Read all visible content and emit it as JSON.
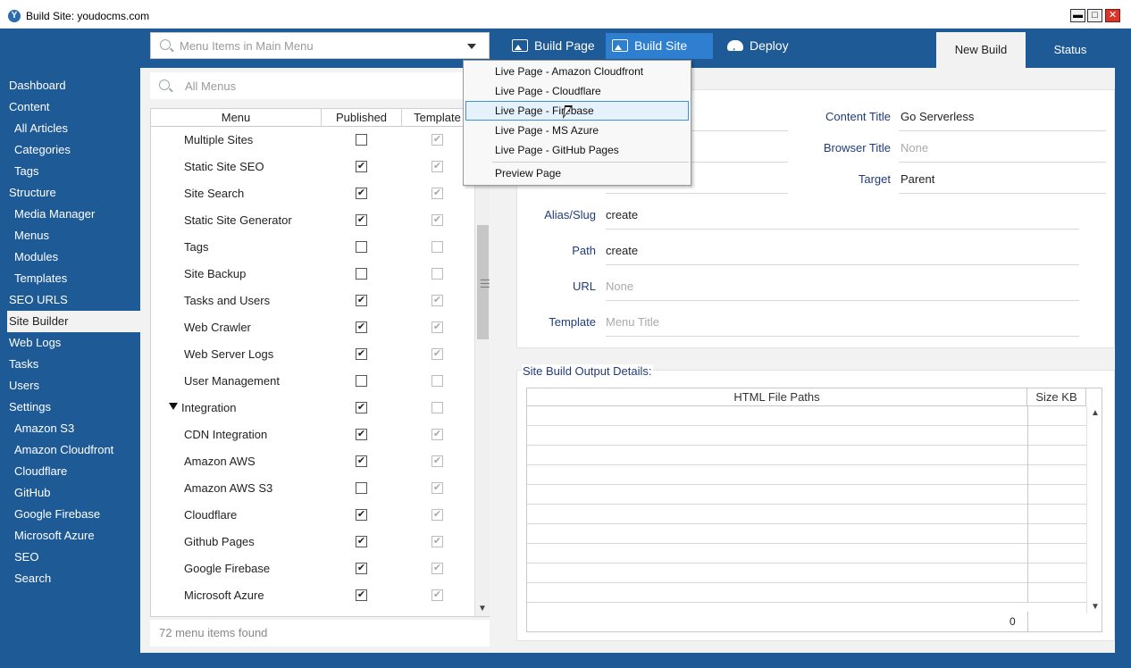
{
  "window": {
    "title": "Build Site: youdocms.com",
    "app_icon": "app-icon",
    "buttons": {
      "minimize": "▬",
      "maximize": "□",
      "close": "✕"
    }
  },
  "toolbar": {
    "menu_search_placeholder": "Menu Items in Main Menu",
    "build_page_label": "Build Page",
    "build_site_label": "Build Site",
    "deploy_label": "Deploy",
    "tabs": [
      {
        "label": "New Build",
        "active": true
      },
      {
        "label": "Status",
        "active": false
      }
    ]
  },
  "sidebar": {
    "active_index": 11,
    "items": [
      {
        "label": "Dashboard",
        "sub": false
      },
      {
        "label": "Content",
        "sub": false
      },
      {
        "label": "All Articles",
        "sub": true
      },
      {
        "label": "Categories",
        "sub": true
      },
      {
        "label": "Tags",
        "sub": true
      },
      {
        "label": "Structure",
        "sub": false
      },
      {
        "label": "Media Manager",
        "sub": true
      },
      {
        "label": "Menus",
        "sub": true
      },
      {
        "label": "Modules",
        "sub": true
      },
      {
        "label": "Templates",
        "sub": true
      },
      {
        "label": "SEO URLS",
        "sub": false
      },
      {
        "label": "Site Builder",
        "sub": false
      },
      {
        "label": "Web Logs",
        "sub": false
      },
      {
        "label": "Tasks",
        "sub": false
      },
      {
        "label": "Users",
        "sub": false
      },
      {
        "label": "Settings",
        "sub": false
      },
      {
        "label": "Amazon S3",
        "sub": true
      },
      {
        "label": "Amazon Cloudfront",
        "sub": true
      },
      {
        "label": "Cloudflare",
        "sub": true
      },
      {
        "label": "GitHub",
        "sub": true
      },
      {
        "label": "Google Firebase",
        "sub": true
      },
      {
        "label": "Microsoft Azure",
        "sub": true
      },
      {
        "label": "SEO",
        "sub": true
      },
      {
        "label": "Search",
        "sub": true
      }
    ]
  },
  "menus_panel": {
    "search_placeholder": "All Menus",
    "columns": {
      "menu": "Menu",
      "published": "Published",
      "template": "Template"
    },
    "rows": [
      {
        "label": "Multiple Sites",
        "published": false,
        "template": true,
        "parent": false
      },
      {
        "label": "Static Site SEO",
        "published": true,
        "template": true,
        "parent": false
      },
      {
        "label": "Site Search",
        "published": true,
        "template": true,
        "parent": false
      },
      {
        "label": "Static Site Generator",
        "published": true,
        "template": true,
        "parent": false
      },
      {
        "label": "Tags",
        "published": false,
        "template": false,
        "parent": false
      },
      {
        "label": "Site Backup",
        "published": false,
        "template": false,
        "parent": false
      },
      {
        "label": "Tasks and Users",
        "published": true,
        "template": true,
        "parent": false
      },
      {
        "label": "Web Crawler",
        "published": true,
        "template": true,
        "parent": false
      },
      {
        "label": "Web Server Logs",
        "published": true,
        "template": true,
        "parent": false
      },
      {
        "label": "User Management",
        "published": false,
        "template": false,
        "parent": false
      },
      {
        "label": "Integration",
        "published": true,
        "template": false,
        "parent": true
      },
      {
        "label": "CDN Integration",
        "published": true,
        "template": true,
        "parent": false
      },
      {
        "label": "Amazon AWS",
        "published": true,
        "template": true,
        "parent": false
      },
      {
        "label": "Amazon AWS S3",
        "published": false,
        "template": true,
        "parent": false
      },
      {
        "label": "Cloudflare",
        "published": true,
        "template": true,
        "parent": false
      },
      {
        "label": "Github Pages",
        "published": true,
        "template": true,
        "parent": false
      },
      {
        "label": "Google Firebase",
        "published": true,
        "template": true,
        "parent": false
      },
      {
        "label": "Microsoft Azure",
        "published": true,
        "template": true,
        "parent": false
      }
    ],
    "count_text": "72 menu items found"
  },
  "details": {
    "content_title_label": "Content Title",
    "content_title_value": "Go Serverless",
    "browser_title_label": "Browser Title",
    "browser_title_value": "None",
    "target_label": "Target",
    "target_value": "Parent",
    "alias_label": "Alias/Slug",
    "alias_value": "create",
    "path_label": "Path",
    "path_value": "create",
    "url_label": "URL",
    "url_value": "None",
    "template_label": "Template",
    "template_value": "Menu Title"
  },
  "output": {
    "title": "Site Build Output Details:",
    "col_paths": "HTML File Paths",
    "col_size": "Size KB",
    "total": "0"
  },
  "build_site_dropdown": {
    "hover_index": 2,
    "items": [
      "Live Page - Amazon Cloudfront",
      "Live Page - Cloudflare",
      "Live Page - Firebase",
      "Live Page - MS Azure",
      "Live Page - GitHub Pages"
    ],
    "preview_label": "Preview Page"
  },
  "colors": {
    "frame_blue": "#1e5a96",
    "active_button_blue": "#2f7fd1",
    "panel_gray": "#f2f2f2",
    "label_navy": "#1f3c7a",
    "hover_bg": "#e5f1fb"
  }
}
